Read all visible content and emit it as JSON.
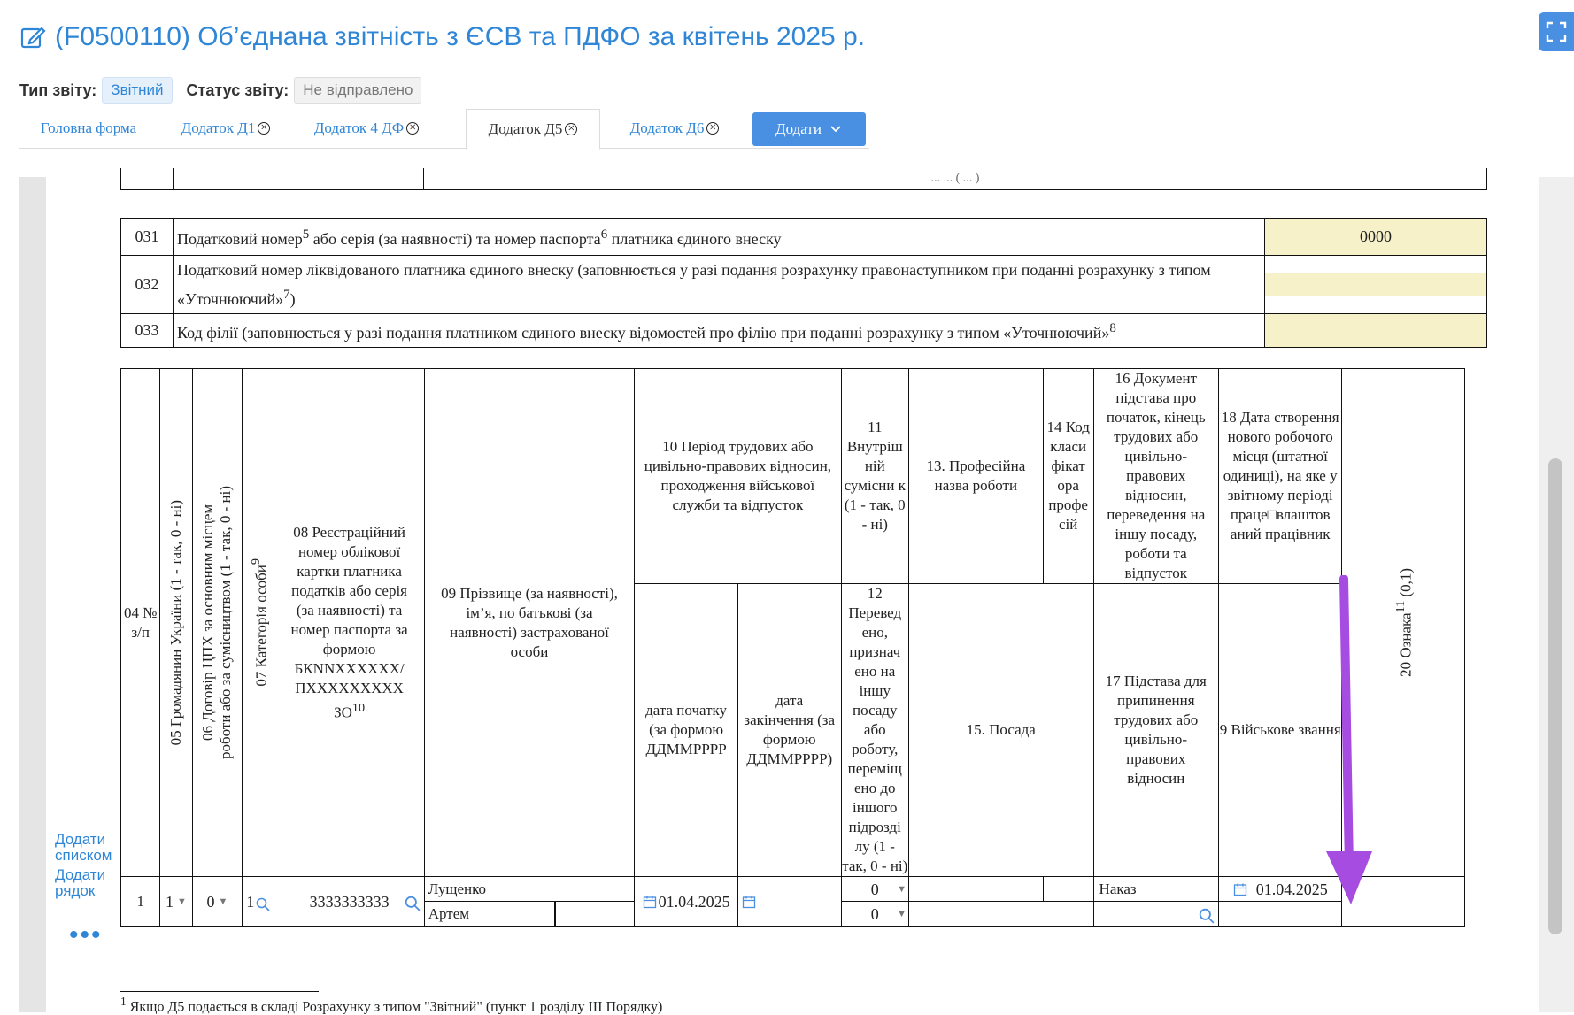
{
  "header": {
    "title": "(F0500110) Об’єднана звітність з ЄСВ та ПДФО за квітень 2025 р.",
    "report_type_label": "Тип звіту:",
    "report_type_value": "Звітний",
    "report_status_label": "Статус звіту:",
    "report_status_value": "Не відправлено"
  },
  "tabs": [
    {
      "label": "Головна форма",
      "closable": false
    },
    {
      "label": "Додаток Д1",
      "closable": true
    },
    {
      "label": "Додаток 4 ДФ",
      "closable": true
    },
    {
      "label": "Додаток Д5",
      "closable": true,
      "active": true
    },
    {
      "label": "Додаток Д6",
      "closable": true
    }
  ],
  "add_button_label": "Додати",
  "top_remnant_text": "... ... ( ... )",
  "codes_rows": [
    {
      "code": "031",
      "text": "Податковий номер",
      "sup1": "5",
      "text2": " або серія (за наявності) та номер паспорта",
      "sup2": "6",
      "text3": " платника єдиного внеску",
      "value": "0000"
    },
    {
      "code": "032",
      "text": "Податковий номер ліквідованого платника єдиного внеску (заповнюється у разі подання розрахунку правонаступником при поданні розрахунку з типом «Уточнюючий»",
      "sup1": "7",
      "text2": ")",
      "value": ""
    },
    {
      "code": "033",
      "text": "Код філії (заповнюється у разі подання платником єдиного внеску відомостей про філію при поданні розрахунку з типом «Уточнюючий»",
      "sup1": "8",
      "text2": "",
      "value": ""
    }
  ],
  "columns": {
    "c04": "04 № з/п",
    "c05": "05 Громадянин України (1 - так, 0 - ні)",
    "c06_line1": "06 Договір ЦПХ за основним місцем",
    "c06_line2": "роботи або за сумісництвом (1 - так, 0 - ні)",
    "c07": "07 Категорія особи",
    "c07_sup": "9",
    "c08": "08 Реєстраційний номер облікової картки платника податків або серія (за наявності) та номер паспорта за формою БКNNXXXXXX/ ПХХХХХХХХХ ЗО",
    "c08_sup": "10",
    "c09": "09 Прізвище (за наявності), ім’я, по батькові (за наявності) застрахованої особи",
    "c10": "10 Період трудових або цивільно-правових відносин, проходження військової служби та відпусток",
    "c10_start": "дата початку (за формою ДДММРРРР",
    "c10_end": "дата закінчення (за формою ДДММРРРР)",
    "c11": "11 Внутріш ній сумісни к (1 - так, 0 - ні)",
    "c12": "12 Перевед ено, признач ено на іншу посаду або роботу, переміщ ено до іншого підрозді лу (1 - так, 0 - ні)",
    "c13": "13. Професійна назва роботи",
    "c14": "14 Код класи фікат ора профе сій",
    "c15": "15. Посада",
    "c16": "16 Документ підстава про початок, кінець трудових або цивільно-правових відносин, переведення на іншу посаду, роботи та відпусток",
    "c17": "17 Підстава для припинення трудових або цивільно-правових відносин",
    "c18": "18 Дата створення нового робочого місця (штатної одиниці), на яке у звітному періоді праце□влаштов аний працівник",
    "c19": "9 Військове звання",
    "c20": "20 Ознака",
    "c20_sup": "11",
    "c20_tail": " (0,1)"
  },
  "row": {
    "num": "1",
    "c05": "1",
    "c06": "0",
    "c07": "1",
    "c08": "3333333333",
    "surname": "Лущенко",
    "name": "Артем",
    "date_start": "01.04.2025",
    "date_end": "",
    "c11": "0",
    "c12": "0",
    "c16": "Наказ",
    "c18": "01.04.2025"
  },
  "side_links": {
    "add_list": "Додати списком",
    "add_row": "Додати рядок",
    "more": "•••"
  },
  "footnote": {
    "sup": "1",
    "text": "Якщо Д5 подається в складі Розрахунку з типом \"Звітний\" (пункт 1 розділу III Порядку)"
  },
  "colors": {
    "accent": "#4a90e2",
    "link": "#2f86d6",
    "input_yellow": "#f7f1c9",
    "arrow": "#a64ce0"
  }
}
